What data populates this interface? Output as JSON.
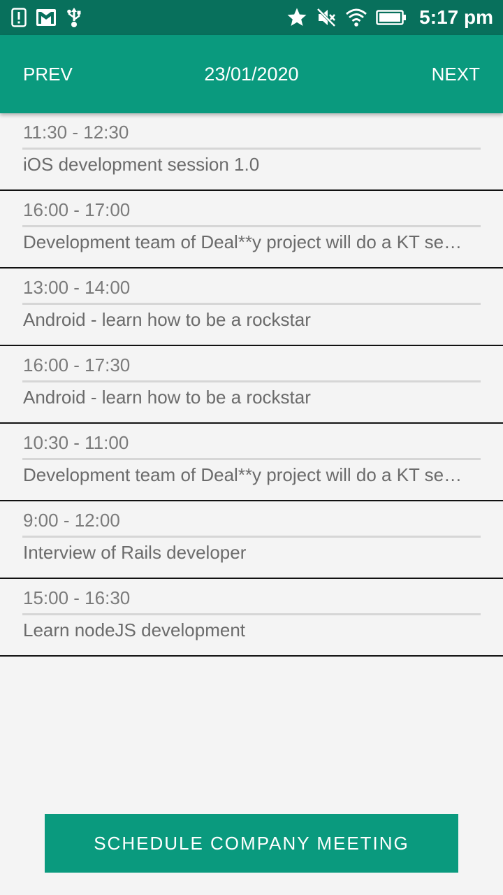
{
  "status_bar": {
    "time": "5:17 pm",
    "left_icons": [
      "alert-icon",
      "gmail-icon",
      "usb-icon"
    ],
    "right_icons": [
      "star-icon",
      "mute-icon",
      "wifi-icon",
      "battery-icon"
    ]
  },
  "header": {
    "prev_label": "PREV",
    "date": "23/01/2020",
    "next_label": "NEXT",
    "color": "#0a9a7e"
  },
  "meetings": [
    {
      "time": "11:30 - 12:30",
      "title": "iOS development session 1.0"
    },
    {
      "time": "16:00 - 17:00",
      "title": "Development team of Deal**y project will do a KT session"
    },
    {
      "time": "13:00 - 14:00",
      "title": "Android - learn how to be a rockstar"
    },
    {
      "time": "16:00 - 17:30",
      "title": "Android - learn how to be a rockstar"
    },
    {
      "time": "10:30 - 11:00",
      "title": "Development team of Deal**y project will do a KT session"
    },
    {
      "time": "9:00 - 12:00",
      "title": "Interview of Rails developer"
    },
    {
      "time": "15:00 - 16:30",
      "title": "Learn nodeJS development"
    }
  ],
  "footer": {
    "schedule_label": "SCHEDULE COMPANY MEETING"
  }
}
